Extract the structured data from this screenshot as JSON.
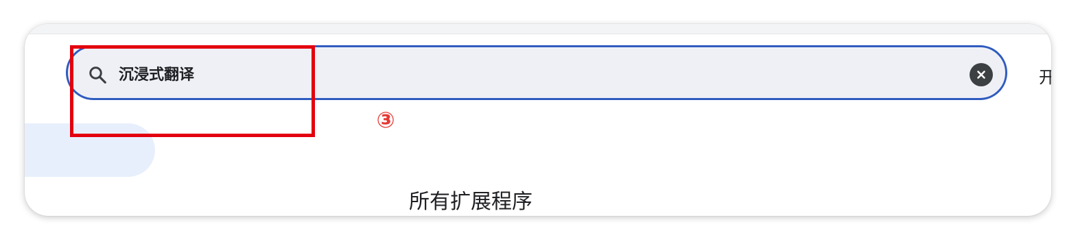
{
  "search": {
    "value": "沉浸式翻译",
    "placeholder": ""
  },
  "header": {
    "truncated_label": "开"
  },
  "annotation": {
    "step_badge": "③",
    "highlight_color": "#e3000f"
  },
  "main": {
    "section_heading": "所有扩展程序"
  },
  "icons": {
    "search": "search-icon",
    "clear": "close-icon"
  },
  "colors": {
    "accent": "#2f5bbf",
    "search_background": "#eff0f6",
    "nav_selected_background": "#e8effc",
    "annotation_red": "#e3000f"
  }
}
